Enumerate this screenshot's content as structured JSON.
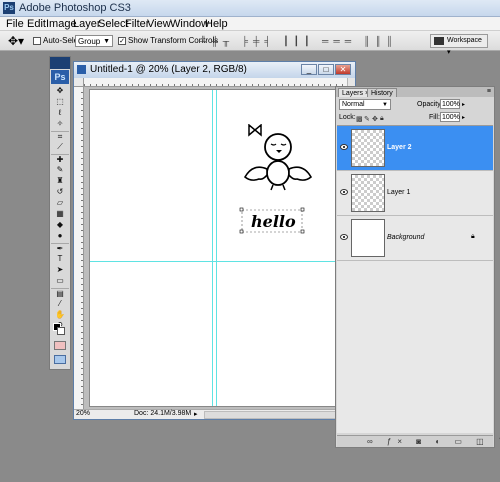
{
  "app": {
    "title": "Adobe Photoshop CS3",
    "logo": "Ps"
  },
  "menu": [
    "File",
    "Edit",
    "Image",
    "Layer",
    "Select",
    "Filter",
    "View",
    "Window",
    "Help"
  ],
  "options": {
    "tool_icon": "move-tool-icon",
    "auto_select_label": "Auto-Select:",
    "auto_select_value": "Group",
    "show_transform_label": "Show Transform Controls",
    "workspace_label": "Workspace"
  },
  "toolbox": {
    "title": "Ps"
  },
  "document": {
    "title": "Untitled-1 @ 20% (Layer 2, RGB/8)",
    "zoom": "20%",
    "doc_size": "Doc: 24.1M/3.98M",
    "artwork_text": "hello"
  },
  "layers_panel": {
    "tabs": [
      "Layers",
      "History"
    ],
    "blend_mode": "Normal",
    "opacity_label": "Opacity:",
    "opacity_value": "100%",
    "lock_label": "Lock:",
    "fill_label": "Fill:",
    "fill_value": "100%",
    "layers": [
      {
        "name": "Layer 2",
        "selected": true
      },
      {
        "name": "Layer 1",
        "selected": false
      },
      {
        "name": "Background",
        "selected": false,
        "locked": true
      }
    ]
  },
  "colors": {
    "selection": "#3b8ff2",
    "guide": "#5fe3e3"
  }
}
